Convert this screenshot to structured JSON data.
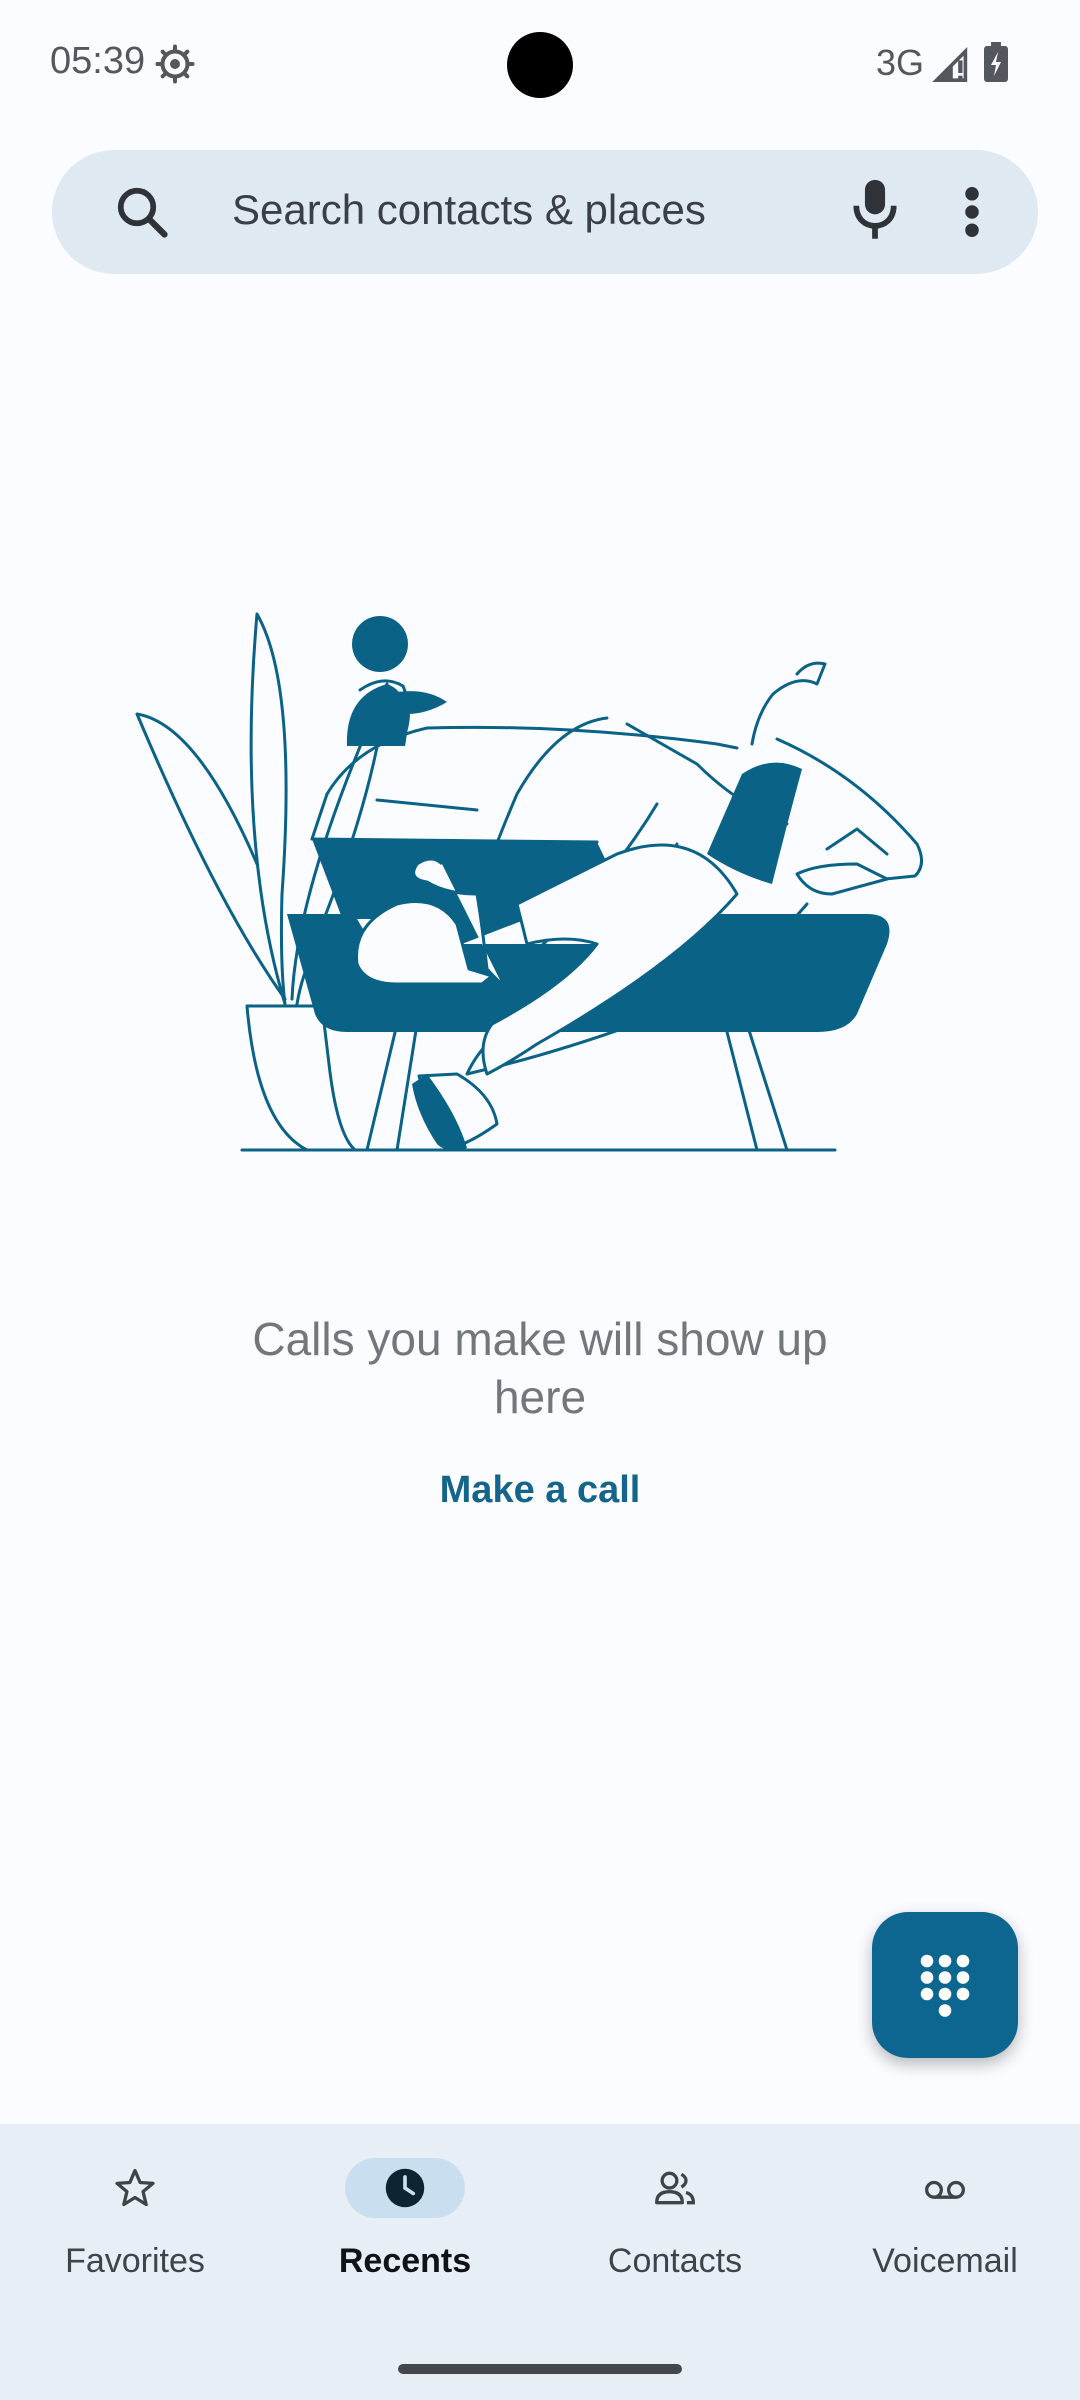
{
  "status_bar": {
    "time": "05:39",
    "network": "3G"
  },
  "search": {
    "placeholder": "Search contacts & places"
  },
  "empty_state": {
    "message": "Calls you make will show up here",
    "action_label": "Make a call"
  },
  "nav": {
    "items": [
      {
        "label": "Favorites",
        "icon": "star-icon",
        "active": false
      },
      {
        "label": "Recents",
        "icon": "clock-icon",
        "active": true
      },
      {
        "label": "Contacts",
        "icon": "contacts-icon",
        "active": false
      },
      {
        "label": "Voicemail",
        "icon": "voicemail-icon",
        "active": false
      }
    ]
  },
  "colors": {
    "accent": "#0d668f",
    "illustration": "#0a6286",
    "search_bg": "#dfe9f1",
    "nav_bg": "#e8eef5"
  }
}
